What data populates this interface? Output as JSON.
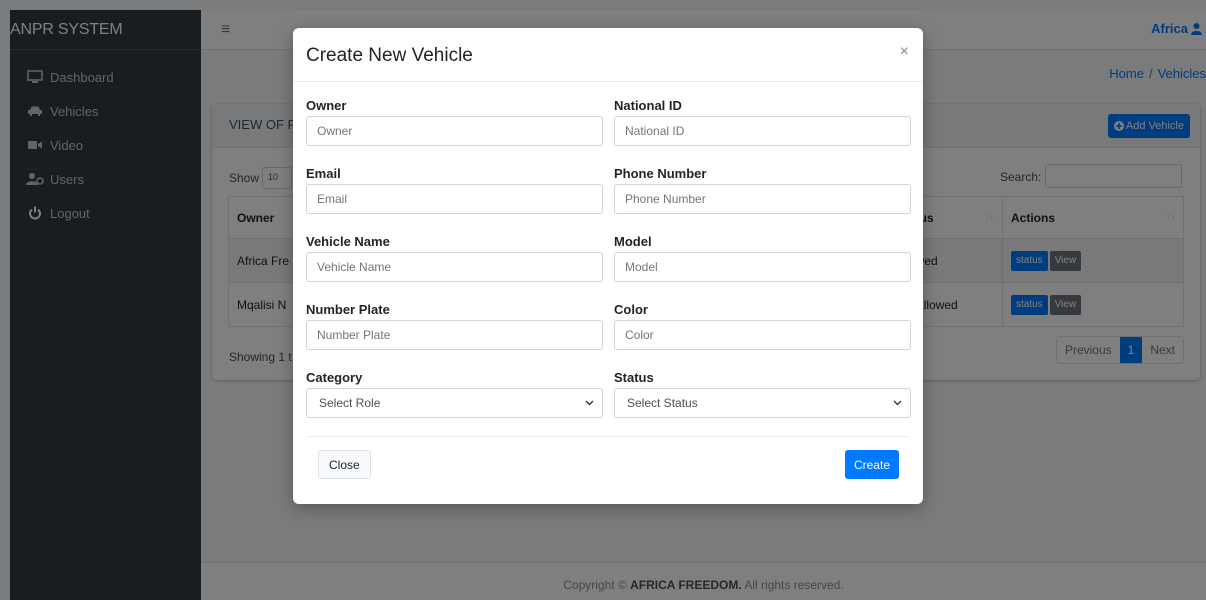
{
  "sidebar": {
    "brand": "ANPR SYSTEM",
    "items": [
      {
        "label": "Dashboard",
        "icon": "monitor-icon"
      },
      {
        "label": "Vehicles",
        "icon": "car-icon"
      },
      {
        "label": "Video",
        "icon": "video-icon"
      },
      {
        "label": "Users",
        "icon": "users-icon"
      },
      {
        "label": "Logout",
        "icon": "power-icon"
      }
    ]
  },
  "topbar": {
    "menu_icon": "≡",
    "user_name": "Africa"
  },
  "breadcrumb": {
    "home": "Home",
    "separator": "/",
    "current": "Vehicles"
  },
  "card": {
    "title": "VIEW OF R",
    "add_button": "Add Vehicle",
    "show_label": "Show",
    "length_value": "10",
    "search_label": "Search:",
    "columns": [
      "Owner",
      "Status",
      "Actions"
    ],
    "rows": [
      {
        "owner": "Africa Fre",
        "status": "allowed"
      },
      {
        "owner": "Mqalisi N",
        "status": "not allowed"
      }
    ],
    "status_btn": "status",
    "view_btn": "View",
    "showing": "Showing 1 t",
    "pager": {
      "prev": "Previous",
      "page": "1",
      "next": "Next"
    }
  },
  "footer": {
    "prefix": "Copyright © ",
    "company": "AFRICA FREEDOM.",
    "suffix": " All rights reserved."
  },
  "modal": {
    "title": "Create New Vehicle",
    "close_x": "×",
    "fields": {
      "owner": {
        "label": "Owner",
        "placeholder": "Owner"
      },
      "national_id": {
        "label": "National ID",
        "placeholder": "National ID"
      },
      "email": {
        "label": "Email",
        "placeholder": "Email"
      },
      "phone": {
        "label": "Phone Number",
        "placeholder": "Phone Number"
      },
      "vehicle_name": {
        "label": "Vehicle Name",
        "placeholder": "Vehicle Name"
      },
      "model": {
        "label": "Model",
        "placeholder": "Model"
      },
      "plate": {
        "label": "Number Plate",
        "placeholder": "Number Plate"
      },
      "color": {
        "label": "Color",
        "placeholder": "Color"
      },
      "category": {
        "label": "Category",
        "value": "Select Role"
      },
      "status": {
        "label": "Status",
        "value": "Select Status"
      }
    },
    "close_button": "Close",
    "create_button": "Create"
  },
  "colors": {
    "primary": "#007bff",
    "sidebar": "#343a40",
    "secondary": "#6c757d"
  }
}
